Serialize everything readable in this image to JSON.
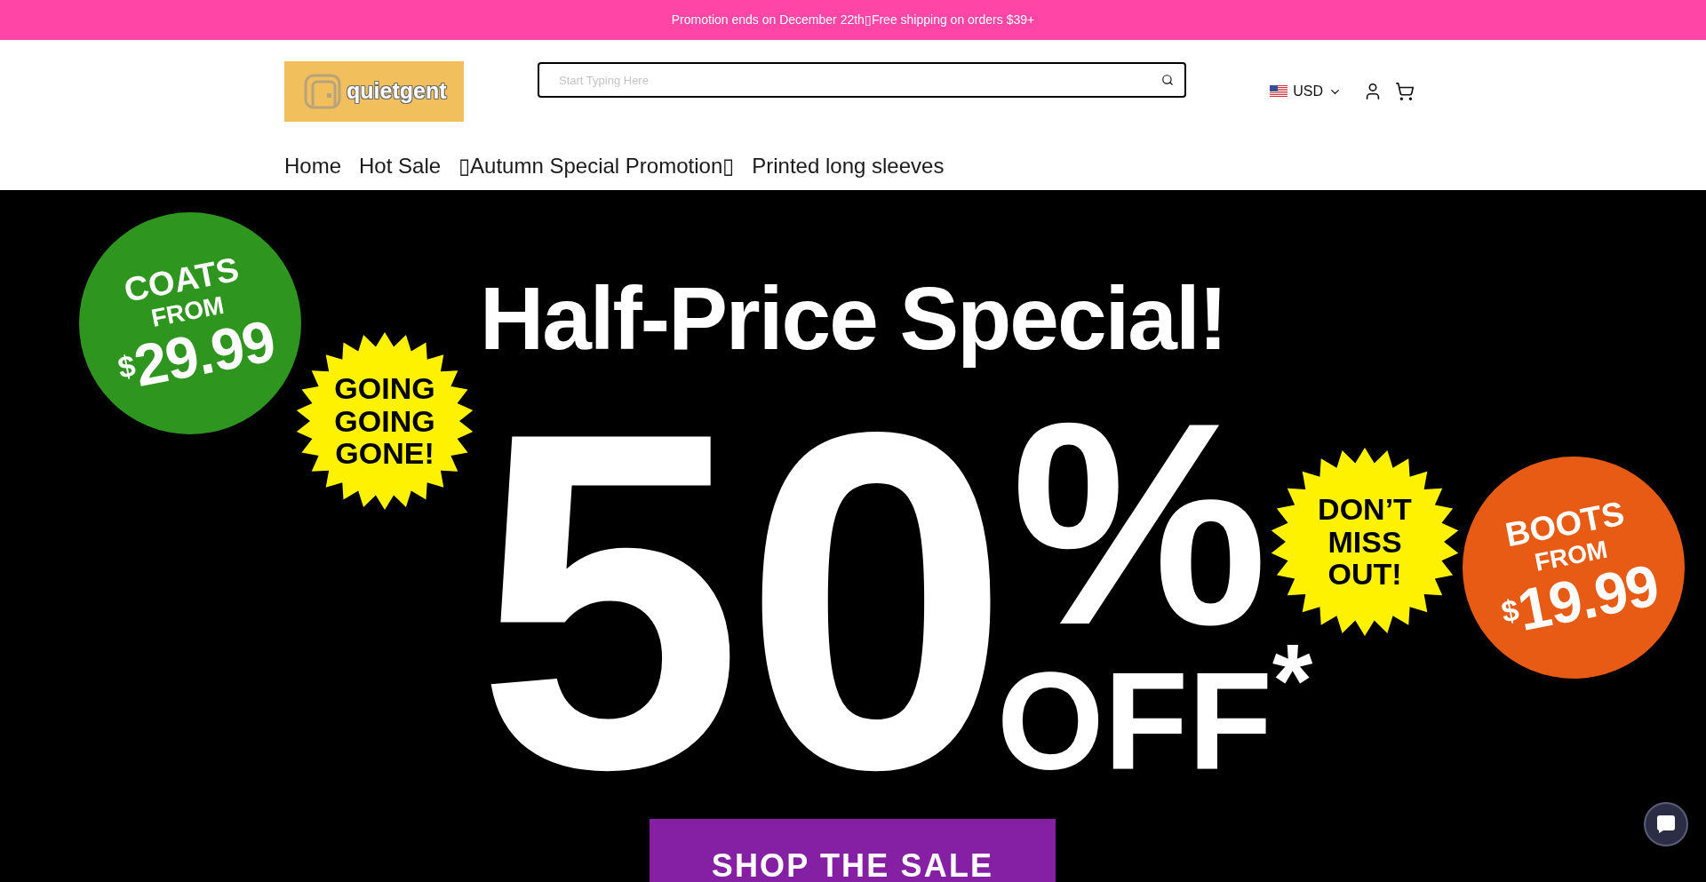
{
  "announcement_bar": {
    "text": "Promotion ends on December 22th▯Free shipping on orders $39+"
  },
  "header": {
    "logo": {
      "text": "quietgent"
    },
    "search": {
      "placeholder": "Start Typing Here"
    },
    "currency": {
      "label": "USD"
    }
  },
  "nav": [
    "Home",
    "Hot Sale",
    "▯Autumn Special Promotion▯",
    "Printed long sleeves"
  ],
  "hero_banner": {
    "headline": "Half-Price Special!",
    "discount_number": "50",
    "percent_sign": "%",
    "off_label": "OFF$^{*}$",
    "badges": [
      {
        "kind": "circle",
        "color": "#2e961f",
        "title": "COATS",
        "subtitle": "FROM",
        "currency": "$",
        "price": "29.99"
      },
      {
        "kind": "starburst",
        "lines": [
          "GOING",
          "GOING",
          "GONE!"
        ]
      },
      {
        "kind": "starburst",
        "lines": [
          "DON’T",
          "MISS",
          "OUT!"
        ]
      },
      {
        "kind": "circle",
        "color": "#e85b14",
        "title": "BOOTS",
        "subtitle": "FROM",
        "currency": "$",
        "price": "19.99"
      }
    ],
    "cta_button": "SHOP THE SALE"
  }
}
